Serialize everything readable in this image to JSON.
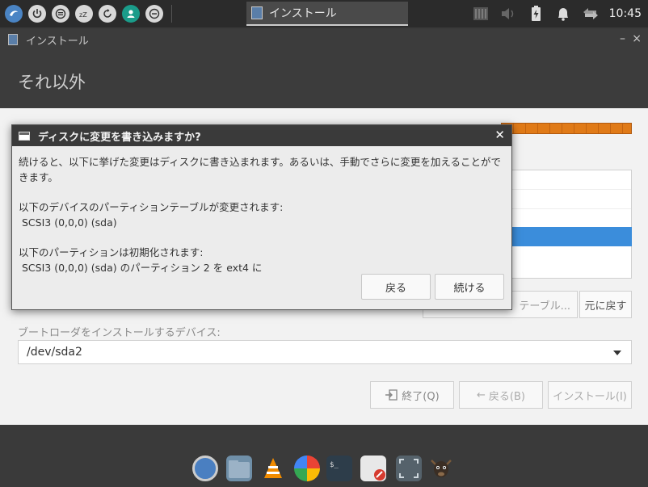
{
  "panel": {
    "task_title": "インストール",
    "clock": "10:45"
  },
  "window": {
    "title": "インストール",
    "minimize": "–",
    "close": "×",
    "header": "それ以外"
  },
  "main": {
    "change_button": "テーブル...",
    "revert_button": "元に戻す",
    "boot_label": "ブートローダをインストールするデバイス:",
    "boot_device": "/dev/sda2",
    "quit_button": "終了(Q)",
    "back_button": "戻る(B)",
    "install_button": "インストール(I)"
  },
  "dialog": {
    "title": "ディスクに変更を書き込みますか?",
    "close": "✕",
    "intro": "続けると、以下に挙げた変更はディスクに書き込まれます。あるいは、手動でさらに変更を加えることができます。",
    "table_heading": "以下のデバイスのパーティションテーブルが変更されます:",
    "table_device": "SCSI3 (0,0,0) (sda)",
    "format_heading": "以下のパーティションは初期化されます:",
    "format_item": "SCSI3 (0,0,0) (sda) のパーティション 2 を ext4 に",
    "back_label": "戻る",
    "continue_label": "続ける"
  },
  "colors": {
    "accent": "#3b8ddb",
    "progress": "#e07a17",
    "panel": "#2b2b2b"
  }
}
